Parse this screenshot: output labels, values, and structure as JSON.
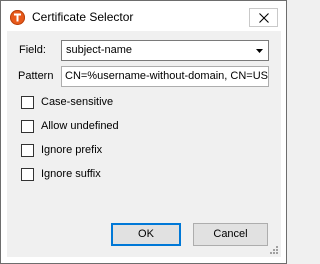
{
  "window": {
    "title": "Certificate Selector",
    "icons": {
      "app": "app-logo-icon",
      "close": "close-icon"
    }
  },
  "form": {
    "field": {
      "label": "Field:",
      "value": "subject-name",
      "icon": "chevron-down-icon"
    },
    "pattern": {
      "label": "Pattern",
      "value": "CN=%username-without-domain, CN=USE"
    },
    "options": [
      {
        "label": "Case-sensitive",
        "checked": false
      },
      {
        "label": "Allow undefined",
        "checked": false
      },
      {
        "label": "Ignore prefix",
        "checked": false
      },
      {
        "label": "Ignore suffix",
        "checked": false
      }
    ]
  },
  "buttons": {
    "ok": "OK",
    "cancel": "Cancel"
  },
  "colors": {
    "accent": "#0078d7",
    "app_icon": "#e8591a",
    "dialog_bg": "#f0f0f0"
  }
}
